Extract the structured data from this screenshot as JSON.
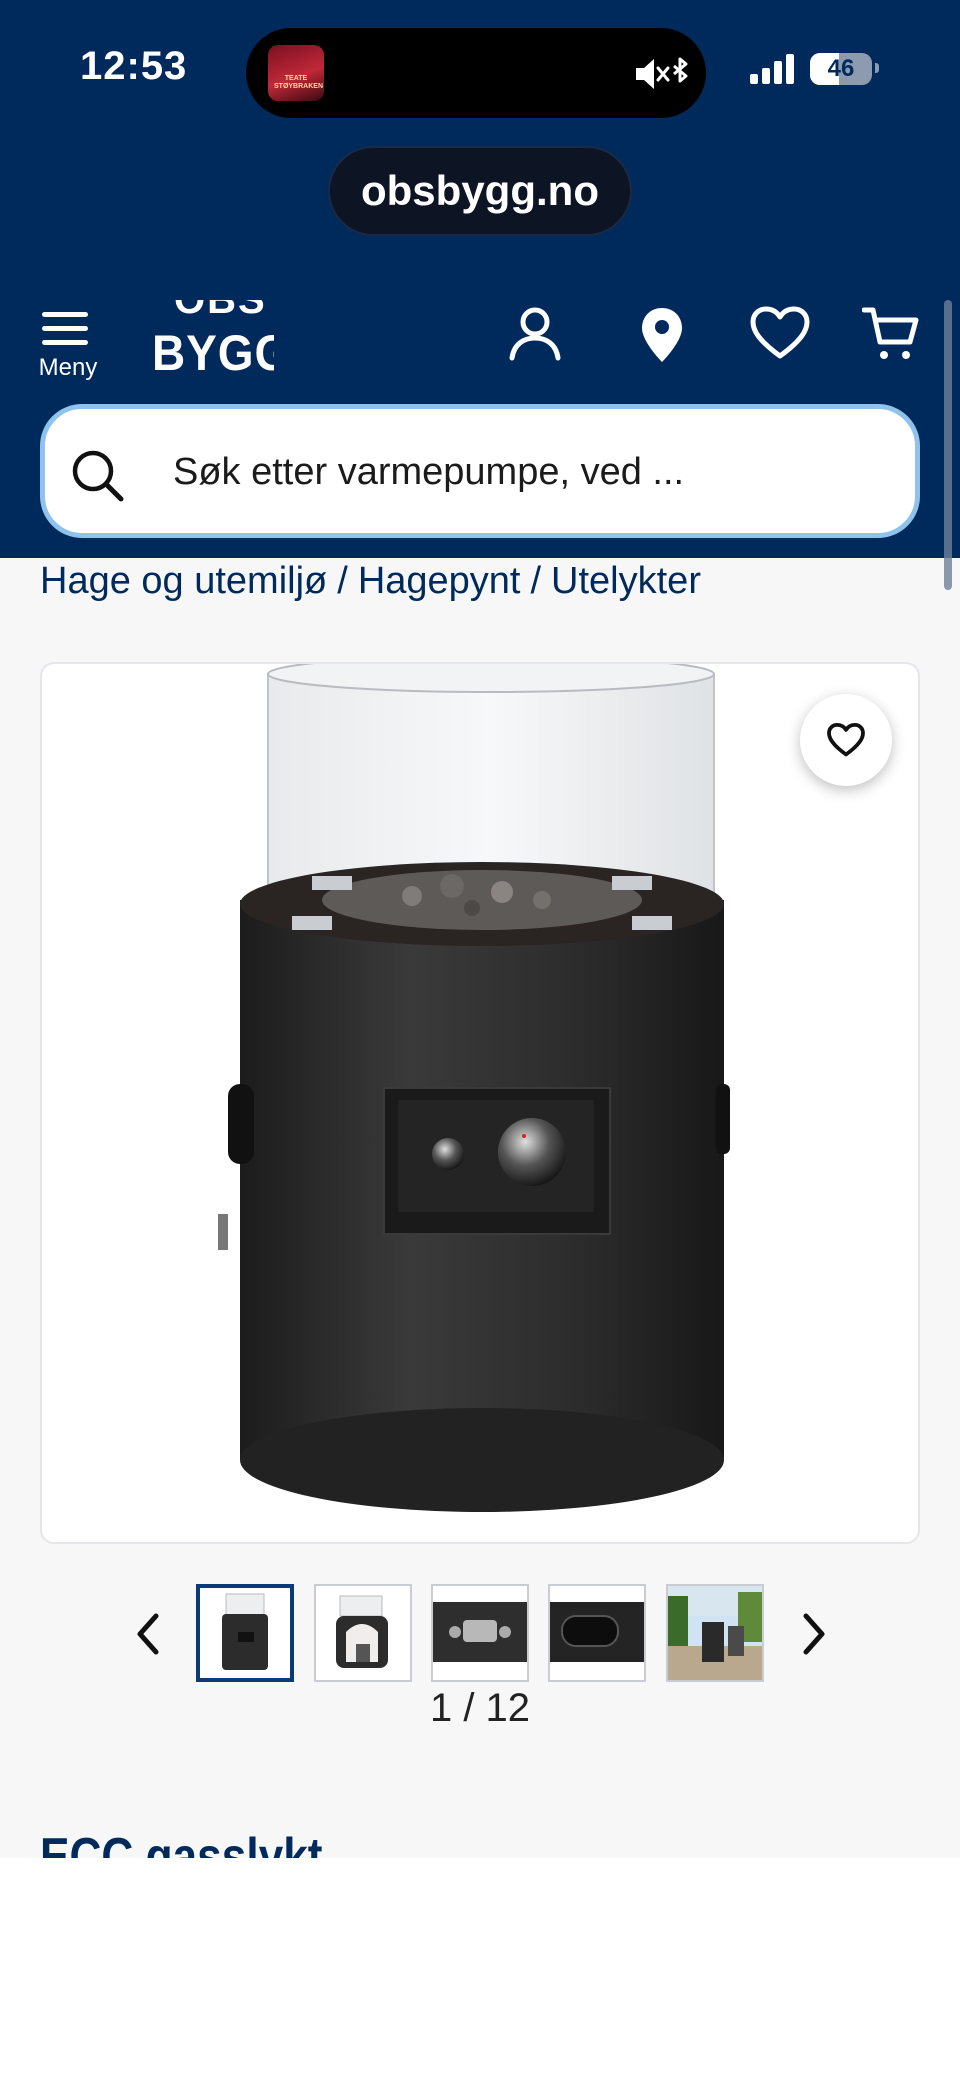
{
  "status_bar": {
    "time": "12:53",
    "battery": "46",
    "now_playing_art_text": "TEATE STØYBRAKEN"
  },
  "browser": {
    "url": "obsbygg.no"
  },
  "header": {
    "menu_label": "Meny",
    "logo_top": "OBS",
    "logo_main": "BYGG",
    "icons": [
      "user-icon",
      "location-icon",
      "heart-icon",
      "cart-icon"
    ]
  },
  "search": {
    "placeholder": "Søk etter varmepumpe, ved ..."
  },
  "breadcrumb": {
    "items": [
      "Hage og utemiljø",
      "Hagepynt",
      "Utelykter"
    ],
    "separator": "/"
  },
  "gallery": {
    "counter": "1 / 12",
    "thumbnails": [
      "thumb-1",
      "thumb-2",
      "thumb-3",
      "thumb-4",
      "thumb-5"
    ],
    "active_index": 0
  },
  "product": {
    "title": "ECC gasslykt"
  },
  "colors": {
    "brand": "#002a5c",
    "search_border": "#8fc3ee",
    "active_thumb": "#0a3a78"
  }
}
